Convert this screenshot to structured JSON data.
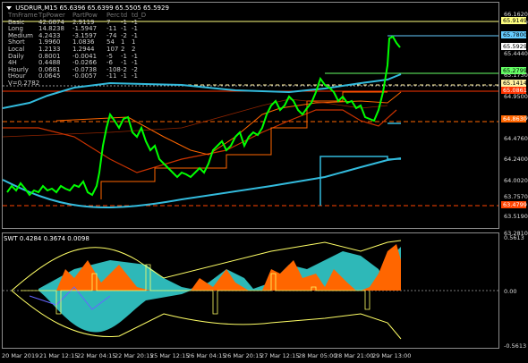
{
  "title": {
    "symbol": "USDRUR,M15",
    "ohlc": "65.6396 65.6399 65.5505 65.5929"
  },
  "table": {
    "header": [
      "TmFrame",
      "TpPower",
      "PartPow",
      "Perc",
      "td",
      "td_D"
    ],
    "rows": [
      [
        "Basic",
        "42.6874",
        "2.9119",
        "7",
        "-1",
        "-1"
      ],
      [
        "Long",
        "14.8238",
        "-1.5947",
        "-11",
        "-1",
        "-1"
      ],
      [
        "Medium",
        "4.2433",
        "-3.1597",
        "-74",
        "-2",
        "-1"
      ],
      [
        "Short",
        "1.9960",
        "1.0836",
        "54",
        "1",
        "1"
      ],
      [
        "Local",
        "1.2133",
        "1.2944",
        "107",
        "2",
        "2"
      ],
      [
        "Daily",
        "0.8001",
        "-0.0041",
        "-5",
        "-1",
        "-1"
      ],
      [
        "4H",
        "0.4488",
        "-0.0266",
        "-6",
        "-1",
        "-1"
      ],
      [
        "Hourly",
        "0.0681",
        "-0.0738",
        "-108",
        "-2",
        "-2"
      ],
      [
        "tHour",
        "0.0645",
        "-0.0057",
        "-11",
        "-1",
        "-1"
      ]
    ],
    "footer": "V=0.2782"
  },
  "y_axis": [
    "66.1620",
    "65.9149",
    "65.4440",
    "65.1730",
    "64.9500",
    "64.7060",
    "64.4760",
    "64.2400",
    "64.0020",
    "63.7570",
    "63.5190",
    "63.2810"
  ],
  "price_tags": [
    {
      "label": "65.9149",
      "bg": "#ffff80",
      "fg": "#000"
    },
    {
      "label": "65.7800",
      "bg": "#66ccff",
      "fg": "#000"
    },
    {
      "label": "65.5929",
      "bg": "#ffffff",
      "fg": "#000"
    },
    {
      "label": "65.2799",
      "bg": "#66ff66",
      "fg": "#000"
    },
    {
      "label": "65.1414",
      "bg": "#fff0a0",
      "fg": "#000"
    },
    {
      "label": "65.0861",
      "bg": "#ff3300",
      "fg": "#fff"
    },
    {
      "label": "64.8630",
      "bg": "#ff6600",
      "fg": "#fff"
    },
    {
      "label": "63.4799",
      "bg": "#ff4400",
      "fg": "#fff"
    }
  ],
  "oscillator": {
    "title": "SWT 0.4284 0.3674 0.0098",
    "top": "0.5613",
    "zero": "0.00",
    "bottom": "-0.5613"
  },
  "x_axis": [
    "20 Mar 2019",
    "21 Mar 12:15",
    "22 Mar 04:15",
    "22 Mar 20:15",
    "25 Mar 12:15",
    "26 Mar 04:15",
    "26 Mar 20:15",
    "27 Mar 12:15",
    "28 Mar 05:00",
    "28 Mar 21:00",
    "29 Mar 13:00"
  ],
  "colors": {
    "candles": "#00ff00",
    "teal": "#33bbdd",
    "red": "#cc3300",
    "orange": "#ff6600",
    "yellow": "#ffff66"
  }
}
